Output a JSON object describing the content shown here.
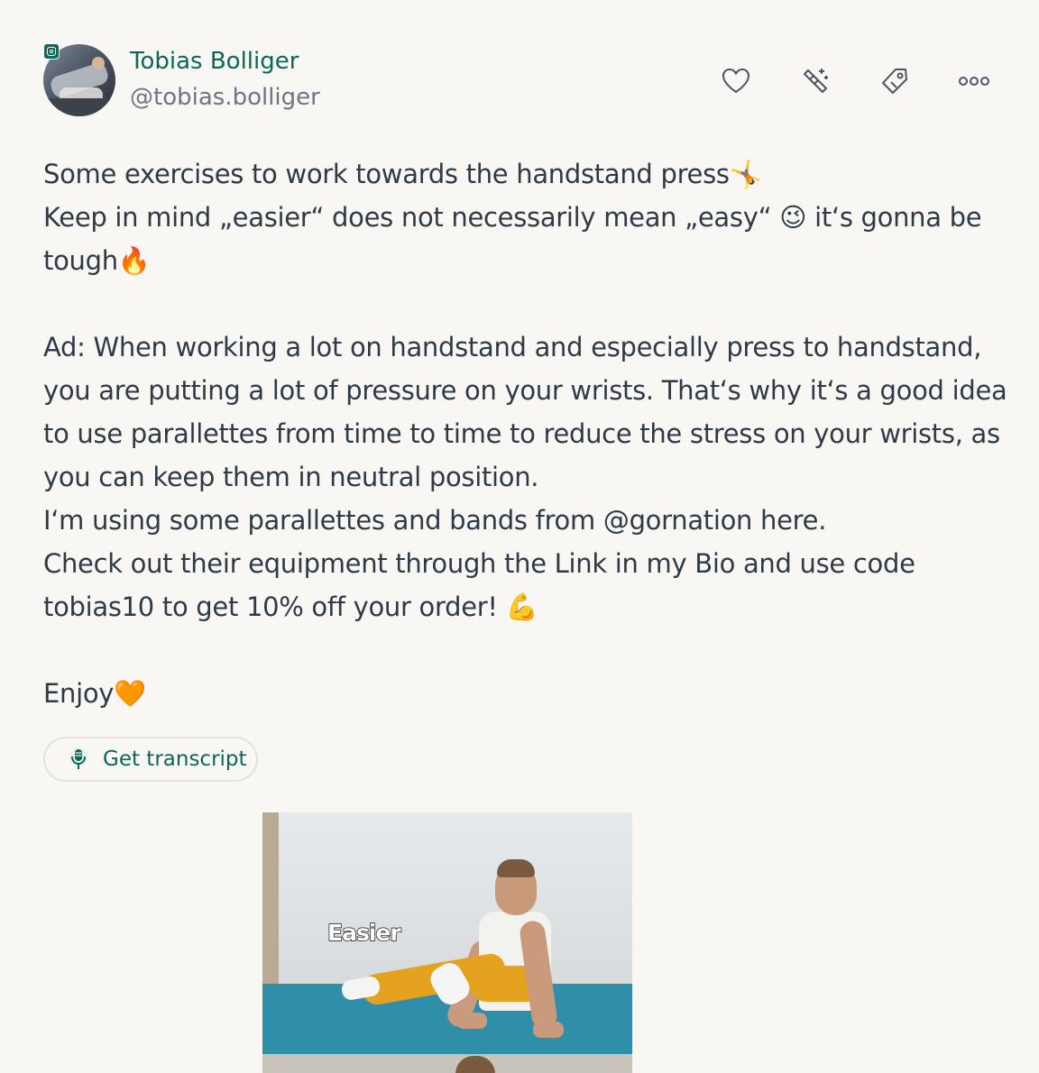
{
  "author": {
    "name": "Tobias Bolliger",
    "handle": "@tobias.bolliger",
    "source_icon": "instagram-icon",
    "avatar": "profile-photo"
  },
  "actions": [
    {
      "name": "like-button",
      "icon": "heart-icon",
      "label": "Like"
    },
    {
      "name": "magic-button",
      "icon": "magic-wand-icon",
      "label": "Magic"
    },
    {
      "name": "tag-button",
      "icon": "tag-icon",
      "label": "Tag"
    },
    {
      "name": "more-button",
      "icon": "more-icon",
      "label": "More"
    }
  ],
  "post": {
    "text": "Some exercises to work towards the handstand press🤸\nKeep in mind „easier“ does not necessarily mean „easy“ 😉 it‘s gonna be tough🔥\n\nAd: When working a lot on handstand and especially press to handstand, you are putting a lot of pressure on your wrists. That‘s why it‘s a good idea to use parallettes from time to time to reduce the stress on your wrists, as you can keep them in neutral position.\nI‘m using some parallettes and bands from @gornation here.\nCheck out their equipment through the Link in my Bio and use code tobias10 to get 10% off your order! 💪\n\nEnjoy🧡"
  },
  "transcript": {
    "label": "Get transcript",
    "icon": "microphone-icon"
  },
  "media": {
    "caption": "Easier",
    "colors": {
      "floor": "#2f8fa8",
      "pants": "#e5a21f"
    }
  },
  "colors": {
    "accent": "#0d6756",
    "text": "#2f3a47",
    "muted": "#6d7682",
    "background": "#f8f7f4",
    "icon": "#4b5563"
  }
}
